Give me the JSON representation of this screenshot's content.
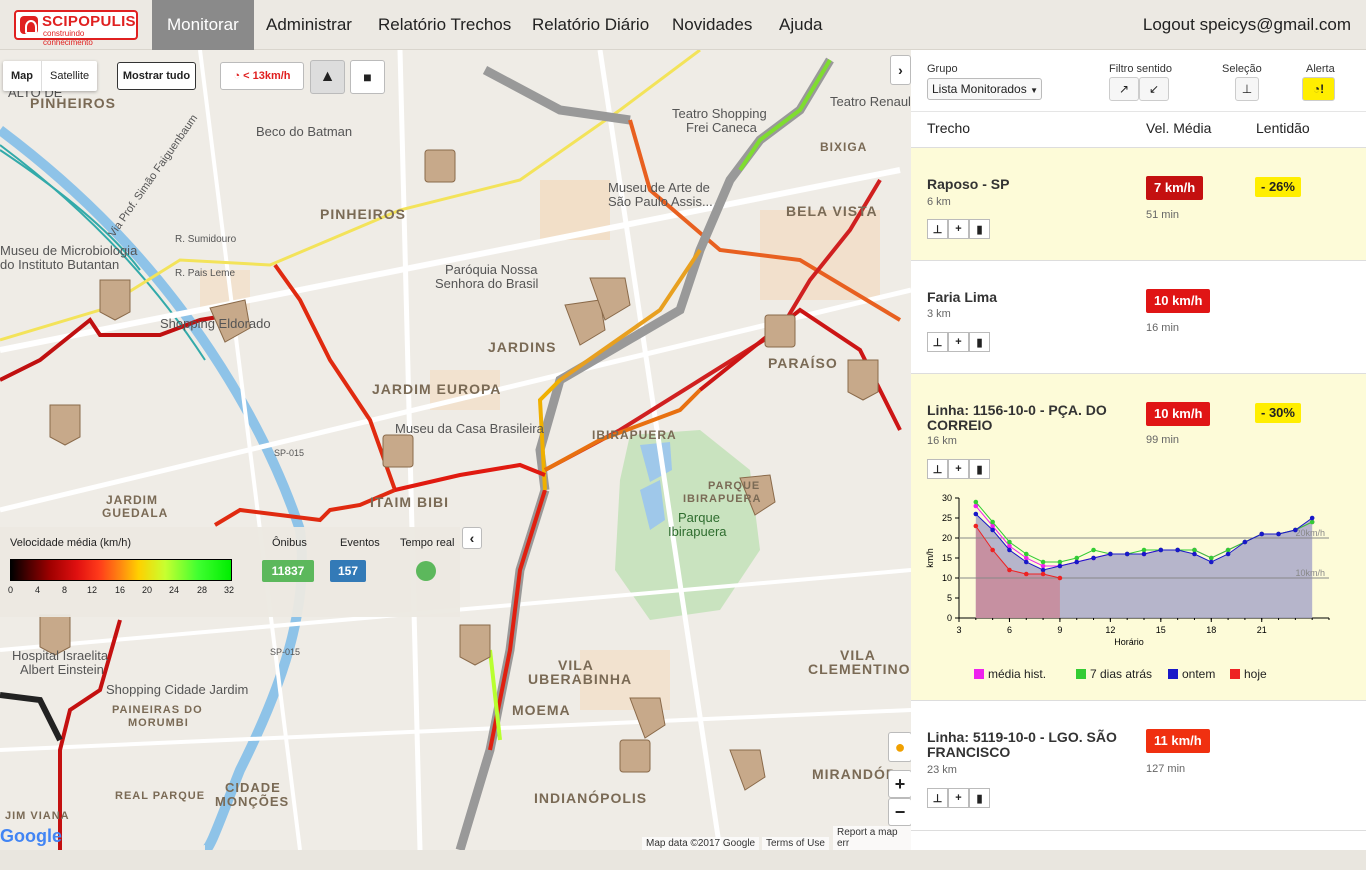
{
  "app": {
    "logo_title": "SCIPOPULIS",
    "logo_sub": "construindo conhecimento"
  },
  "nav": {
    "items": [
      "Monitorar",
      "Administrar",
      "Relatório Trechos",
      "Relatório Diário",
      "Novidades",
      "Ajuda"
    ],
    "logout": "Logout speicys@gmail.com"
  },
  "map": {
    "type_map": "Map",
    "type_satellite": "Satellite",
    "show_all": "Mostrar tudo",
    "speed_filter": "< 13km/h",
    "labels": [
      "ALTO DE",
      "PINHEIROS",
      "Beco do Batman",
      "Via Prof. Simão Faiguenbaum",
      "Museu de Microbiologia",
      "do Instituto Butantan",
      "R. Sumidouro",
      "R. Pais Leme",
      "Shopping Eldorado",
      "PINHEIROS",
      "Paróquia Nossa",
      "Senhora do Brasil",
      "JARDINS",
      "JARDIM EUROPA",
      "Museu da Casa Brasileira",
      "IBIRAPUERA",
      "Parque",
      "Ibirapuera",
      "PARQUE",
      "IBIRAPUERA",
      "Teatro Shopping",
      "Frei Caneca",
      "Museu de Arte de",
      "São Paulo Assis...",
      "BELA VISTA",
      "BIXIGA",
      "PARAÍSO",
      "Teatro Renault",
      "ITAIM BIBI",
      "JARDIM",
      "GUEDALA",
      "Hospital Israelita",
      "Albert Einstein",
      "Shopping Cidade Jardim",
      "PAINEIRAS DO",
      "MORUMBI",
      "VILA",
      "UBERABINHA",
      "VILA",
      "CLEMENTINO",
      "INDIANÓPOLIS",
      "MIRANDÓP",
      "CIDADE",
      "MONÇÕES",
      "REAL PARQUE",
      "JIM VIANA",
      "MOEMA",
      "SP-015",
      "SP-015"
    ],
    "attribution": [
      "Map data ©2017 Google",
      "Terms of Use",
      "Report a map err"
    ],
    "google": "Google"
  },
  "legend": {
    "title": "Velocidade média (km/h)",
    "ticks": [
      "0",
      "4",
      "8",
      "12",
      "16",
      "20",
      "24",
      "28",
      "32"
    ],
    "onibus_label": "Ônibus",
    "onibus_value": "11837",
    "eventos_label": "Eventos",
    "eventos_value": "157",
    "tempo_label": "Tempo real"
  },
  "panel": {
    "grupo_label": "Grupo",
    "grupo_value": "Lista Monitorados",
    "filtro_label": "Filtro sentido",
    "selecao_label": "Seleção",
    "alerta_label": "Alerta",
    "col_trecho": "Trecho",
    "col_vel": "Vel. Média",
    "col_lent": "Lentidão",
    "rows": [
      {
        "name": "Raposo - SP",
        "km": "6 km",
        "speed": "7 km/h",
        "mins": "51 min",
        "lent": "- 26%",
        "color": "#c41010"
      },
      {
        "name": "Faria Lima",
        "km": "3 km",
        "speed": "10 km/h",
        "mins": "16 min",
        "lent": "",
        "color": "#e01515"
      },
      {
        "name": "Linha: 1156-10-0 - PÇA. DO CORREIO",
        "km": "16 km",
        "speed": "10 km/h",
        "mins": "99 min",
        "lent": "- 30%",
        "color": "#e01515"
      },
      {
        "name": "Linha: 5119-10-0 - LGO. SÃO FRANCISCO",
        "km": "23 km",
        "speed": "11 km/h",
        "mins": "127 min",
        "lent": "",
        "color": "#f03010"
      }
    ]
  },
  "chart_data": {
    "type": "line",
    "xlabel": "Horário",
    "ylabel": "km/h",
    "xlim": [
      3,
      25
    ],
    "ylim": [
      0,
      30
    ],
    "xticks": [
      3,
      6,
      9,
      12,
      15,
      18,
      21
    ],
    "yticks": [
      0,
      5,
      10,
      15,
      20,
      25,
      30
    ],
    "ref_lines": [
      {
        "y": 20,
        "label": "20km/h"
      },
      {
        "y": 10,
        "label": "10km/h"
      }
    ],
    "series": [
      {
        "name": "média hist.",
        "color": "#ee22ee",
        "x": [
          4,
          5,
          6,
          7,
          8,
          9,
          10,
          11,
          12,
          13,
          14,
          15,
          16,
          17,
          18,
          19,
          20,
          21,
          22,
          23,
          24
        ],
        "y": [
          28,
          23,
          18,
          15,
          13,
          13,
          14,
          15,
          16,
          16,
          16,
          17,
          17,
          17,
          15,
          17,
          19,
          21,
          21,
          22,
          24
        ]
      },
      {
        "name": "7 dias atrás",
        "color": "#33cc33",
        "x": [
          4,
          5,
          6,
          7,
          8,
          9,
          10,
          11,
          12,
          13,
          14,
          15,
          16,
          17,
          18,
          19,
          20,
          21,
          22,
          23,
          24
        ],
        "y": [
          29,
          24,
          19,
          16,
          14,
          14,
          15,
          17,
          16,
          16,
          17,
          17,
          17,
          17,
          15,
          17,
          19,
          21,
          21,
          22,
          24
        ]
      },
      {
        "name": "ontem",
        "color": "#1818c8",
        "x": [
          4,
          5,
          6,
          7,
          8,
          9,
          10,
          11,
          12,
          13,
          14,
          15,
          16,
          17,
          18,
          19,
          20,
          21,
          22,
          23,
          24
        ],
        "y": [
          26,
          22,
          17,
          14,
          12,
          13,
          14,
          15,
          16,
          16,
          16,
          17,
          17,
          16,
          14,
          16,
          19,
          21,
          21,
          22,
          25
        ]
      },
      {
        "name": "hoje",
        "color": "#ee2222",
        "x": [
          4,
          5,
          6,
          7,
          8,
          9
        ],
        "y": [
          23,
          17,
          12,
          11,
          11,
          10
        ]
      }
    ]
  }
}
